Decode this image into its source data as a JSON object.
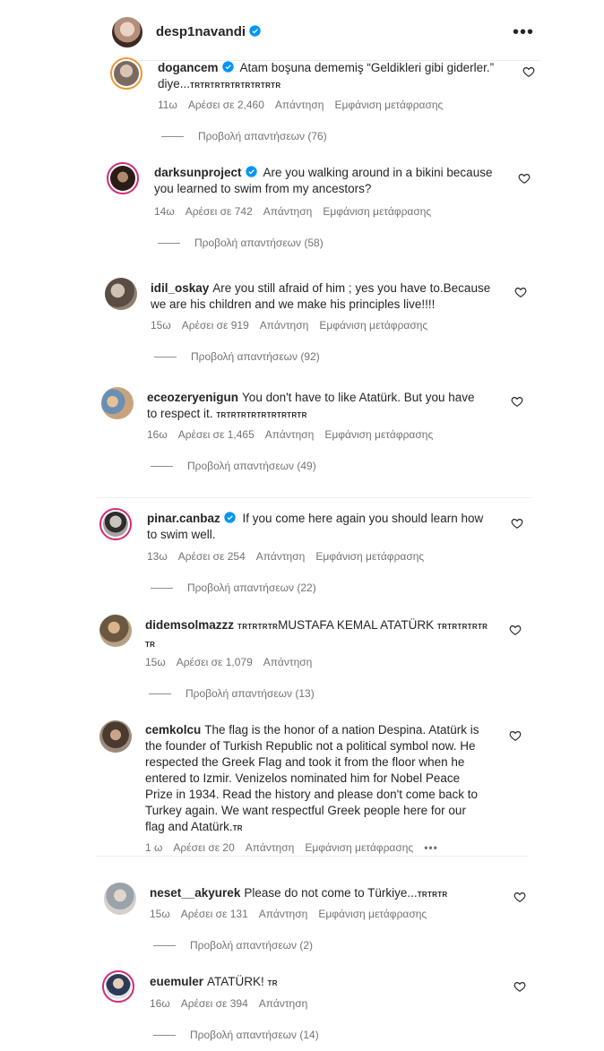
{
  "header": {
    "username": "desp1navandi",
    "more_label": "•••"
  },
  "actions": {
    "reply": "Απάντηση",
    "translate": "Εμφάνιση μετάφρασης"
  },
  "comments": [
    {
      "username": "dogancem",
      "verified": true,
      "text_line1": "Atam boşuna dememiş “Geldikleri gibi giderler.”",
      "text_line2": "diye...",
      "flag": "TRTRTRTRTRTRTRTRTR",
      "time": "11ω",
      "likes": "Αρέσει σε 2,460",
      "replies": "Προβολή απαντήσεων (76)"
    },
    {
      "username": "darksunproject",
      "verified": true,
      "text_line1": "Are you walking around in a bikini because",
      "text_line2": "you learned to swim from my ancestors?",
      "time": "14ω",
      "likes": "Αρέσει σε 742",
      "replies": "Προβολή απαντήσεων (58)"
    },
    {
      "username": "idil_oskay",
      "text_line1": "Are you still afraid of him ; yes you have to.Because",
      "text_line2": "we are his children and we make his principles live!!!!",
      "time": "15ω",
      "likes": "Αρέσει σε 919",
      "replies": "Προβολή απαντήσεων (92)"
    },
    {
      "username": "eceozeryenigun",
      "text_line1": "You don't have to like Atatürk. But you have",
      "text_line2": "to respect it.",
      "flag": "TRTRTRTRTRTRTRTRTR",
      "time": "16ω",
      "likes": "Αρέσει σε 1,465",
      "replies": "Προβολή απαντήσεων (49)"
    },
    {
      "username": "pinar.canbaz",
      "verified": true,
      "text_line1": "If you come here again you should learn how",
      "text_line2": "to swim well.",
      "time": "13ω",
      "likes": "Αρέσει σε 254",
      "replies": "Προβολή απαντήσεων (22)"
    },
    {
      "username": "didemsolmazzz",
      "flag_pre": "TRTRTRTR",
      "text_line1": "MUSTAFA KEMAL ATATÜRK",
      "flag_post": "TRTRTRTRTR",
      "flag_line2": "TR",
      "time": "15ω",
      "likes": "Αρέσει σε 1,079",
      "replies": "Προβολή απαντήσεων (13)"
    },
    {
      "username": "cemkolcu",
      "text_lines": [
        "The flag is the honor of a nation Despina. Atatürk is",
        "the founder of Turkish Republic not a political symbol now. He",
        "respected the Greek Flag and took it from the floor when he",
        "entered to Izmir. Venizelos nominated him for Nobel Peace",
        "Prize in 1934. Read the history and please don't come back to",
        "Turkey again. We want respectful Greek people here for our",
        "flag and Atatürk."
      ],
      "flag": "TR",
      "time": "1 ω",
      "likes": "Αρέσει σε 20",
      "more": "•••"
    },
    {
      "username": "neset__akyurek",
      "text_line1": "Please do not come to Türkiye...",
      "flag": "TRTRTR",
      "time": "15ω",
      "likes": "Αρέσει σε 131",
      "replies": "Προβολή απαντήσεων (2)"
    },
    {
      "username": "euemuler",
      "text_line1": "ATATÜRK!",
      "flag": "TR",
      "time": "16ω",
      "likes": "Αρέσει σε 394",
      "replies": "Προβολή απαντήσεων (14)"
    }
  ]
}
